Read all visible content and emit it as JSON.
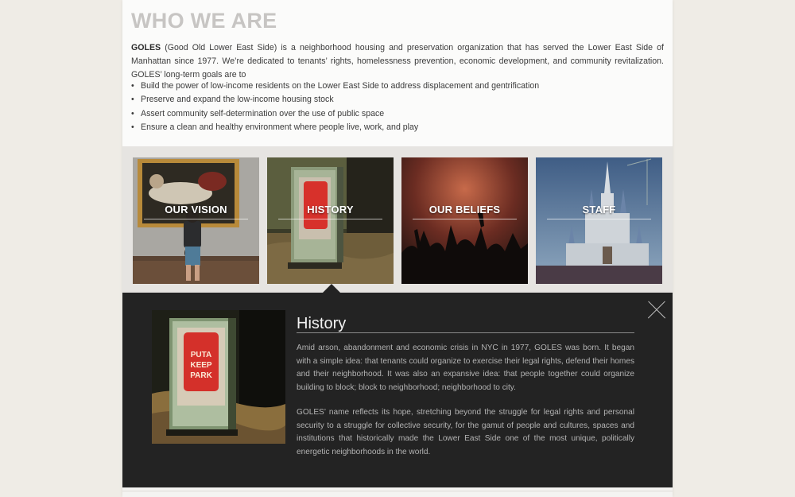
{
  "intro": {
    "title": "WHO WE ARE",
    "org_name": "GOLES",
    "description": "(Good Old Lower East Side) is a neighborhood housing and preservation organization that has served the Lower East Side of Manhattan since 1977. We’re dedicated to tenants’ rights, homelessness prevention, economic development, and community revitalization. GOLES’ long-term goals are to",
    "goals": [
      "Build the power of low-income residents on the Lower East Side to address displacement and gentrification",
      "Preserve and expand the low-income housing stock",
      "Assert community self-determination over the use of public space",
      "Ensure a clean and healthy environment where people live, work, and play"
    ]
  },
  "tiles": [
    {
      "label": "OUR VISION"
    },
    {
      "label": "HISTORY"
    },
    {
      "label": "OUR BELIEFS"
    },
    {
      "label": "STAFF"
    }
  ],
  "detail": {
    "title": "History",
    "paragraphs": [
      "Amid arson, abandonment and economic crisis in NYC in 1977, GOLES was born. It began with a simple idea: that tenants could organize to exercise their legal rights, defend their homes and their neighborhood. It was also an expansive idea: that people together could organize building to block; block to neighborhood; neighborhood to city.",
      "GOLES’ name reflects its hope, stretching beyond the struggle for legal rights and personal security to a struggle for collective security, for the gamut of people and cultures, spaces and institutions that historically made the Lower East Side one of the most unique, politically energetic neighborhoods in the world."
    ],
    "sign_text": [
      "PUTA",
      "KEEP",
      "PARK"
    ]
  },
  "icons": {
    "close": "close-icon"
  }
}
